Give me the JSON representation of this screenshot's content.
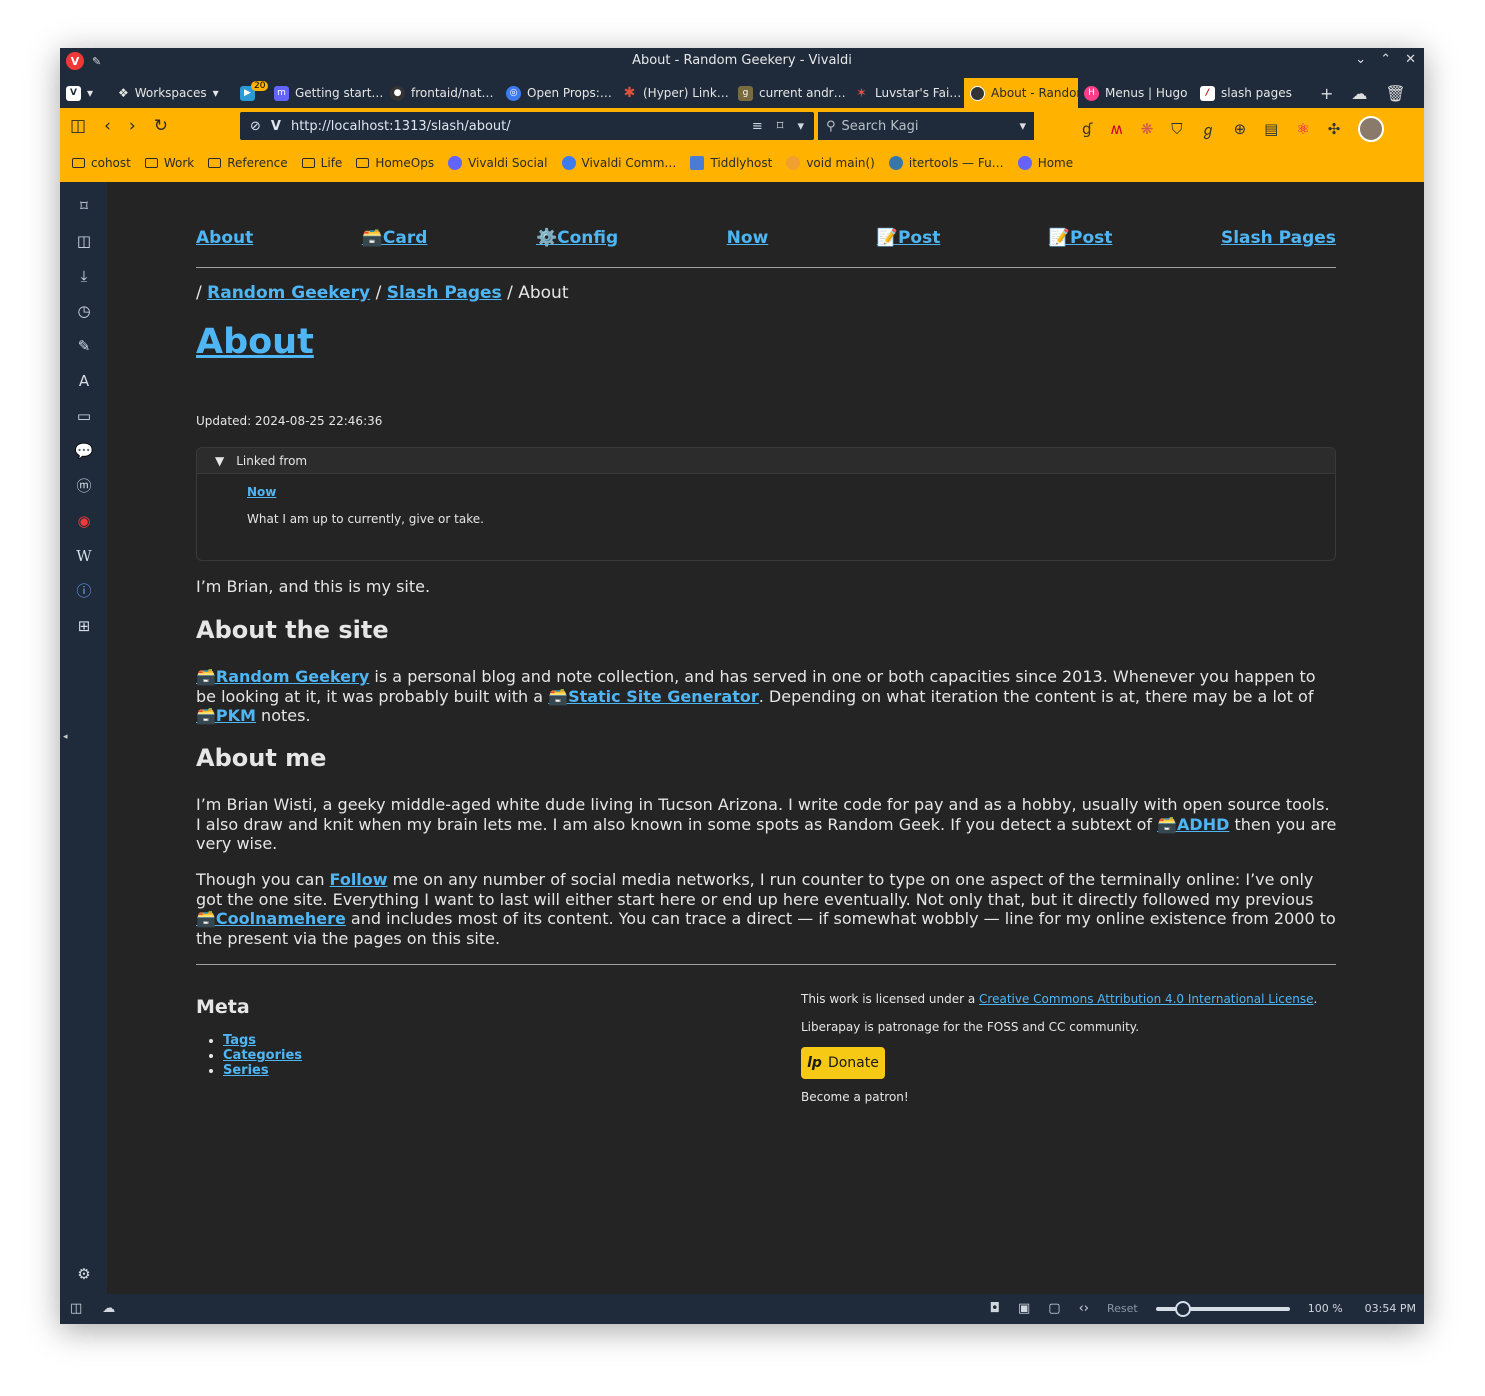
{
  "window": {
    "title": "About - Random Geekery - Vivaldi"
  },
  "tabs": [
    {
      "label": "Workspaces",
      "color": "#1f2b3b"
    },
    {
      "label": "",
      "badge": "20",
      "color": "#2b9bd6"
    },
    {
      "label": "Getting start…",
      "color": "#6364ff"
    },
    {
      "label": "frontaid/nat…",
      "color": "#333333"
    },
    {
      "label": "Open Props:…",
      "color": "#3d7cf0"
    },
    {
      "label": "(Hyper) Link…",
      "color": "#e0513b"
    },
    {
      "label": "current andr…",
      "color": "#7a6a40"
    },
    {
      "label": "Luvstar's Fai…",
      "color": "#e0513b"
    },
    {
      "label": "About - Random",
      "color": "#333333"
    },
    {
      "label": "Menus | Hugo",
      "color": "#ff4088"
    },
    {
      "label": "slash pages",
      "color": "#ffffff"
    }
  ],
  "address": {
    "url": "http://localhost:1313/slash/about/",
    "search_placeholder": "Search Kagi"
  },
  "bookmarks": [
    {
      "label": "cohost",
      "type": "folder"
    },
    {
      "label": "Work",
      "type": "folder"
    },
    {
      "label": "Reference",
      "type": "folder"
    },
    {
      "label": "Life",
      "type": "folder"
    },
    {
      "label": "HomeOps",
      "type": "folder"
    },
    {
      "label": "Vivaldi Social",
      "type": "site",
      "color": "#6364ff"
    },
    {
      "label": "Vivaldi Comm…",
      "type": "site",
      "color": "#3d7cf0"
    },
    {
      "label": "Tiddlyhost",
      "type": "site",
      "color": "#4a7cd6"
    },
    {
      "label": "void main()",
      "type": "site",
      "color": "#f0a030"
    },
    {
      "label": "itertools — Fu…",
      "type": "site",
      "color": "#3776ab"
    },
    {
      "label": "Home",
      "type": "site",
      "color": "#6364ff"
    }
  ],
  "page": {
    "nav": [
      "About",
      "🗃️Card",
      "⚙️Config",
      "Now",
      "📝Post",
      "📝Post",
      "Slash Pages"
    ],
    "breadcrumb": {
      "sep": "/",
      "home": "Random Geekery",
      "section": "Slash Pages",
      "current": "About"
    },
    "title": "About",
    "updated": "Updated: 2024-08-25 22:46:36",
    "linked_from": {
      "summary": "Linked from",
      "link": "Now",
      "desc": "What I am up to currently, give or take."
    },
    "intro": "I’m Brian, and this is my site.",
    "h_site": "About the site",
    "site_p": {
      "link1": "🗃️Random Geekery",
      "t1": " is a personal blog and note collection, and has served in one or both capacities since 2013. Whenever you happen to be looking at it, it was probably built with a ",
      "link2": "🗃️Static Site Generator",
      "t2": ". Depending on what iteration the content is at, there may be a lot of ",
      "link3": "🗃️PKM",
      "t3": " notes."
    },
    "h_me": "About me",
    "me_p1": {
      "t1": "I’m Brian Wisti, a geeky middle-aged white dude living in Tucson Arizona. I write code for pay and as a hobby, usually with open source tools. I also draw and knit when my brain lets me. I am also known in some spots as Random Geek. If you detect a subtext of ",
      "link": "🗃️ADHD",
      "t2": " then you are very wise."
    },
    "me_p2": {
      "t1": "Though you can ",
      "link1": "Follow",
      "t2": " me on any number of social media networks, I run counter to type on one aspect of the terminally online: I’ve only got the one site. Everything I want to last will either start here or end up here eventually. Not only that, but it directly followed my previous ",
      "link2": "🗃️Coolnamehere",
      "t3": " and includes most of its content. You can trace a direct — if somewhat wobbly — line for my online existence from 2000 to the present via the pages on this site."
    },
    "meta": {
      "heading": "Meta",
      "items": [
        "Tags",
        "Categories",
        "Series"
      ]
    },
    "license": {
      "pre": "This work is licensed under a ",
      "link": "Creative Commons Attribution 4.0 International License",
      "post": "."
    },
    "liberapay": "Liberapay is patronage for the FOSS and CC community.",
    "donate": "Donate",
    "patron": "Become a patron!"
  },
  "status": {
    "reset": "Reset",
    "zoom": "100 %",
    "zoom_level": 0.2,
    "time": "03:54 PM"
  },
  "colors": {
    "accent": "#ffb300",
    "chrome": "#1f2b3b",
    "link": "#4fb6f5",
    "page_bg": "#242424"
  }
}
